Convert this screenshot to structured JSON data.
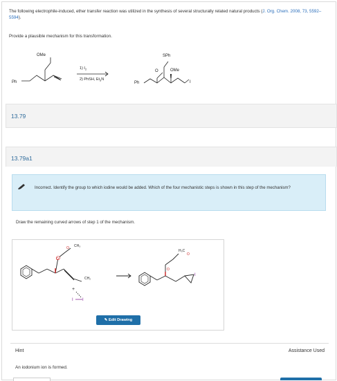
{
  "intro": {
    "text_before_link": "The following electrophile-induced, ether transfer reaction was utilized in the synthesis of several structurally related natural products (",
    "link_text": "J. Org. Chem. 2008, 73, 5592–5594",
    "text_after_link": ")."
  },
  "prompt": "Provide a plausible mechanism for this transformation.",
  "scheme": {
    "reactant_ome": "OMe",
    "reactant_ph": "Ph",
    "reagent_1": "1) I",
    "reagent_1_sub": "2",
    "reagent_2": "2) PhSH, Et",
    "reagent_2_sub": "3",
    "reagent_2_end": "N",
    "product_sph": "SPh",
    "product_o": "O",
    "product_ome": "OMe",
    "product_ph": "Ph",
    "product_i": "I"
  },
  "sections": {
    "problem_id": "13.79",
    "subproblem_id": "13.79a1"
  },
  "alert": {
    "icon": "pencil-icon",
    "text": "Incorrect. Identify the group to which iodine would be added. Which of the four mechanistic steps is shown in this step of the mechanism?"
  },
  "draw_instruction": "Draw the remaining curved arrows of step 1 of the mechanism.",
  "canvas": {
    "left_ch3": "CH₃",
    "left_ch2": "CH₂",
    "left_o": "O",
    "left_i_plus": "+",
    "left_i": "I",
    "right_h3c": "H₃C",
    "right_i": "I",
    "edit_button": "Edit Drawing",
    "edit_icon": "pencil-icon"
  },
  "hint": {
    "label": "Hint",
    "assistance": "Assistance Used",
    "text": "An iodonium ion is formed."
  },
  "colors": {
    "link": "#2a6ebb",
    "section_title": "#2e6b9b",
    "alert_bg": "#d9eef8",
    "button": "#1f6fa8",
    "oxygen_red": "#cc2222",
    "iodine_purple": "#8a2a9a"
  }
}
